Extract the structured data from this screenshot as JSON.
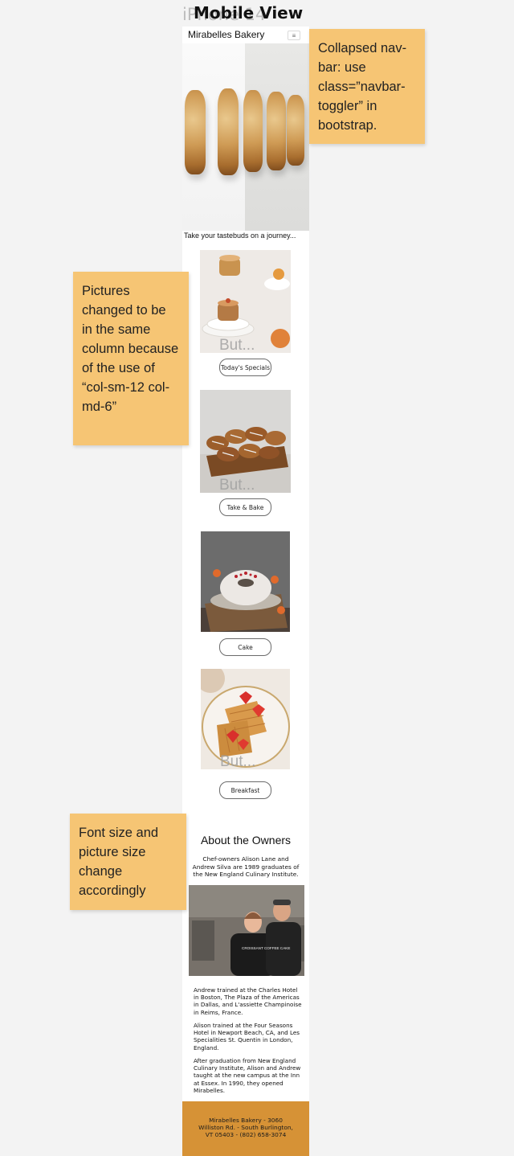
{
  "frame": {
    "ghost_label": "iPhone 14",
    "title": "Mobile View"
  },
  "navbar": {
    "brand": "Mirabelles Bakery",
    "toggler_icon": "hamburger-icon"
  },
  "hero": {
    "tagline": "Take your tastebuds on a journey..."
  },
  "cards": [
    {
      "overlay": "But...",
      "button": "Today's Specials"
    },
    {
      "overlay": "But...",
      "button": "Take & Bake"
    },
    {
      "overlay": "",
      "button": "Cake"
    },
    {
      "overlay": "But...",
      "button": "Breakfast"
    }
  ],
  "about": {
    "title": "About the Owners",
    "intro": "Chef-owners Alison Lane and Andrew Silva are 1989 graduates of the New England Culinary Institute.",
    "paragraphs": [
      "Andrew trained at the Charles Hotel in Boston, The Plaza of the Americas in Dallas, and L'assiette Champinoise in Reims, France.",
      "Alison trained at the Four Seasons Hotel in Newport Beach, CA, and Les Specialities St. Quentin in London, England.",
      "After graduation from New England Culinary Institute, Alison and Andrew taught at the new campus at the Inn at Essex. In 1990, they opened Mirabelles."
    ],
    "shirt_text": "CROISSANT COFFEE CAKE"
  },
  "footer": {
    "text": "Mirabelles Bakery - 3060 Williston Rd. - South Burlington, VT 05403 - (802) 658-3074"
  },
  "notes": [
    "Collapsed nav-bar: use class=”navbar-toggler” in bootstrap.",
    "Pictures changed to be in the same column because of the use of “col-sm-12 col-md-6”",
    "Font size and picture size change accordingly"
  ],
  "colors": {
    "note_yellow": "#f6c574",
    "footer_orange": "#d69236",
    "canvas": "#f3f3f3"
  }
}
